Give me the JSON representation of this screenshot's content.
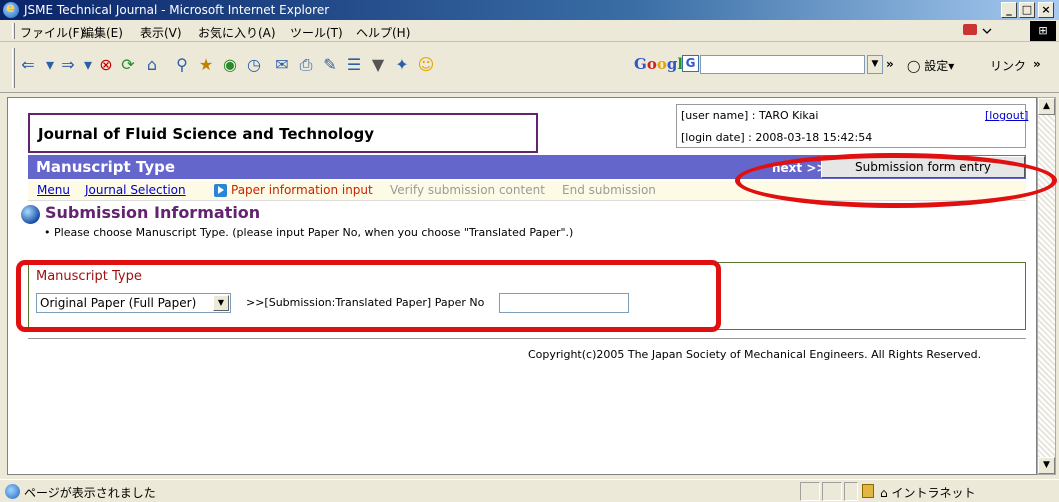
{
  "window": {
    "title": "JSME Technical Journal - Microsoft Internet Explorer"
  },
  "menu": [
    "ファイル(F)",
    "編集(E)",
    "表示(V)",
    "お気に入り(A)",
    "ツール(T)",
    "ヘルプ(H)"
  ],
  "toolbar": {
    "settings_label": "設定",
    "links_label": "リンク",
    "more": "»"
  },
  "header": {
    "journal_title": "Journal of Fluid Science and Technology",
    "user_name": "[user name] : TARO Kikai",
    "login_date": "[login date] : 2008-03-18 15:42:54",
    "logout": "[logout]"
  },
  "manuscript_bar": {
    "title": "Manuscript Type",
    "next": "next >>",
    "entry_button": "Submission form entry"
  },
  "steps": {
    "menu": "Menu",
    "journal_selection": "Journal Selection",
    "paper_info": "Paper information input",
    "verify": "Verify submission content",
    "end": "End submission"
  },
  "section": {
    "title": "Submission Information",
    "note": "Please choose Manuscript Type. (please input Paper No, when you choose \"Translated Paper\".)"
  },
  "form": {
    "label": "Manuscript Type",
    "selected": "Original Paper (Full Paper)",
    "paper_no_label": ">>[Submission:Translated Paper] Paper No",
    "paper_no_value": ""
  },
  "footer": {
    "copyright": "Copyright(c)2005 The Japan Society of Mechanical Engineers. All Rights Reserved."
  },
  "status": {
    "text": "ページが表示されました",
    "zone": "イントラネット"
  },
  "colors": {
    "title_bar": "#0a246a",
    "journal_border": "#63236e",
    "manuscript_bar": "#6566cb",
    "annotation": "#e01010",
    "steps_bg": "#fdfbe5"
  }
}
